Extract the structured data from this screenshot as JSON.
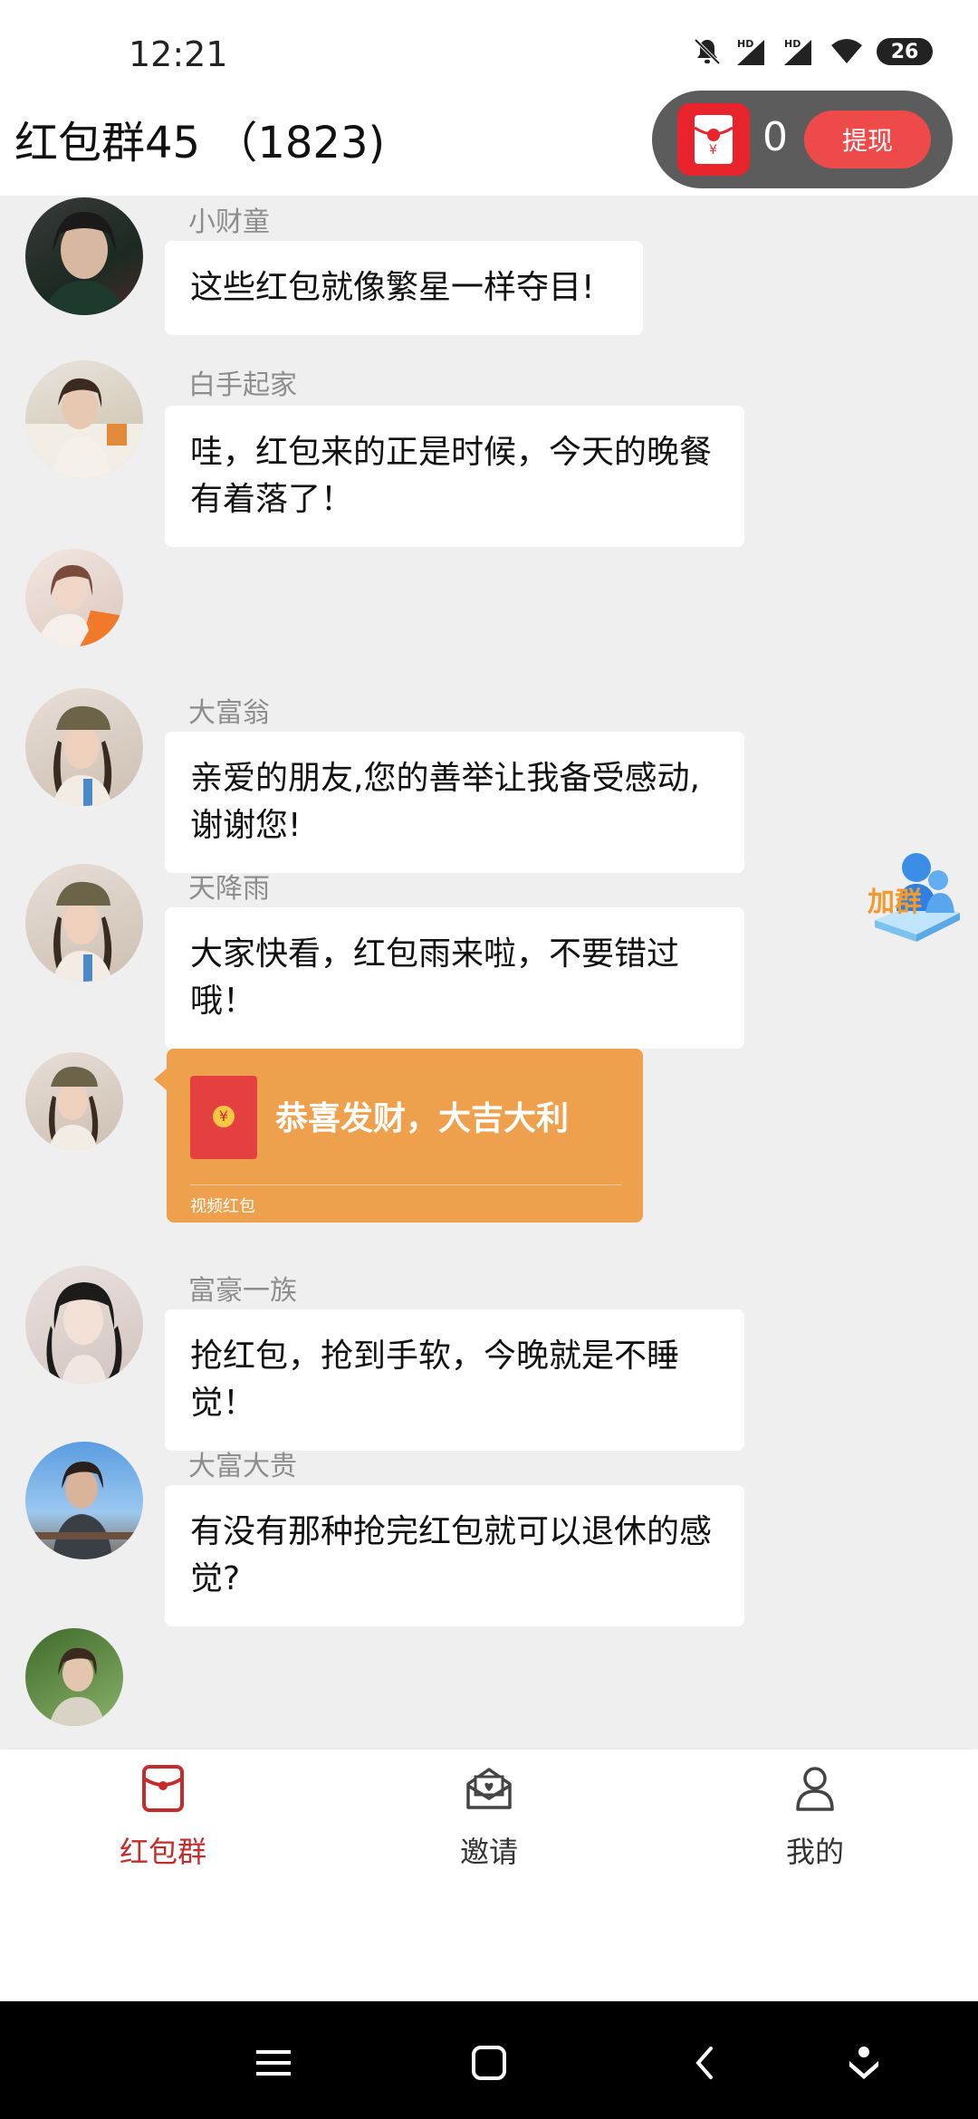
{
  "status_bar": {
    "time": "12:21",
    "battery": "26"
  },
  "header": {
    "title": "红包群45 （1823)",
    "redpacket_count": "0",
    "withdraw_label": "提现"
  },
  "messages": [
    {
      "sender": "小财童",
      "text": "这些红包就像繁星一样夺目!"
    },
    {
      "sender": "白手起家",
      "text": "哇，红包来的正是时候，今天的晚餐有着落了！"
    },
    {
      "sender": "大富翁",
      "text": "亲爱的朋友,您的善举让我备受感动,谢谢您!"
    },
    {
      "sender": "天降雨",
      "text": "大家快看，红包雨来啦，不要错过哦！"
    },
    {
      "sender": "富豪一族",
      "text": "抢红包，抢到手软，今晚就是不睡觉！"
    },
    {
      "sender": "大富大贵",
      "text": "有没有那种抢完红包就可以退休的感觉?"
    }
  ],
  "red_packet": {
    "title": "恭喜发财，大吉大利",
    "label": "视频红包",
    "coin_symbol": "¥"
  },
  "join_group": {
    "label": "加群"
  },
  "bottom_nav": [
    {
      "label": "红包群",
      "icon": "red-packet-icon",
      "active": true
    },
    {
      "label": "邀请",
      "icon": "invite-mail-icon",
      "active": false
    },
    {
      "label": "我的",
      "icon": "profile-icon",
      "active": false
    }
  ],
  "colors": {
    "accent": "#c42b2b",
    "withdraw": "#ee4a4a",
    "chat_bg": "#efefef",
    "red_packet_bubble": "#eea04d"
  }
}
